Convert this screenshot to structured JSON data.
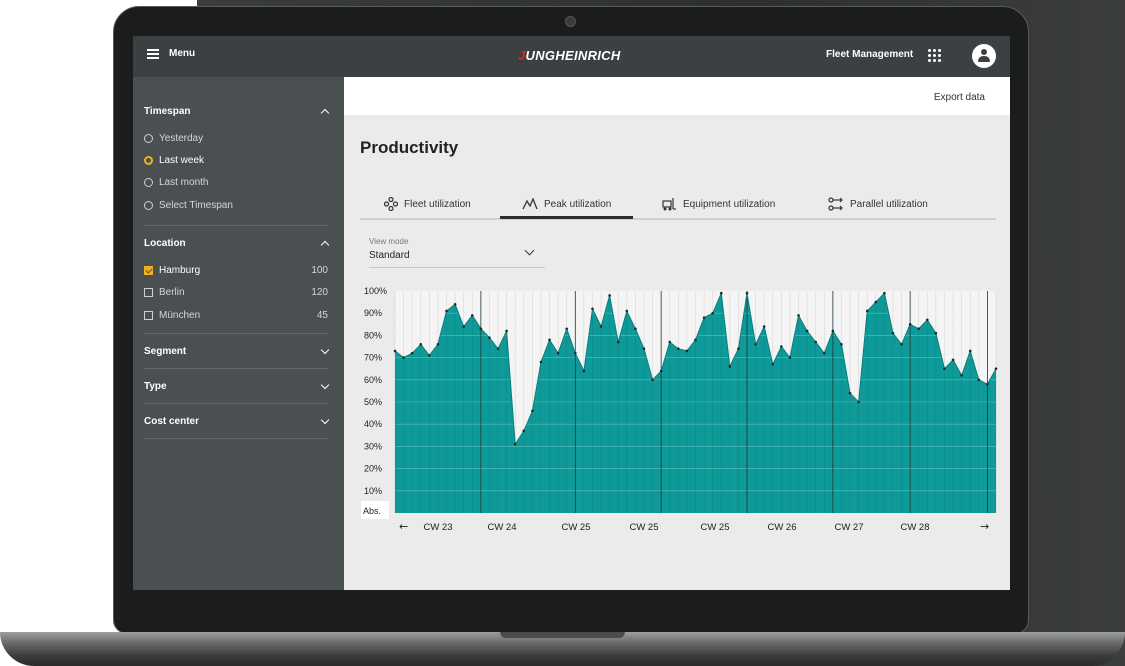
{
  "header": {
    "menu_label": "Menu",
    "logo_text_j": "J",
    "logo_text_rest": "UNGHEINRICH",
    "app_name": "Fleet Management"
  },
  "sidebar": {
    "timespan": {
      "label": "Timespan",
      "options": [
        {
          "label": "Yesterday",
          "selected": false
        },
        {
          "label": "Last week",
          "selected": true
        },
        {
          "label": "Last month",
          "selected": false
        },
        {
          "label": "Select Timespan",
          "selected": false
        }
      ]
    },
    "location": {
      "label": "Location",
      "options": [
        {
          "label": "Hamburg",
          "count": "100",
          "checked": true
        },
        {
          "label": "Berlin",
          "count": "120",
          "checked": false
        },
        {
          "label": "München",
          "count": "45",
          "checked": false
        }
      ]
    },
    "segment_label": "Segment",
    "type_label": "Type",
    "cost_center_label": "Cost center"
  },
  "main": {
    "export_label": "Export data",
    "title": "Productivity",
    "tabs": [
      {
        "label": "Fleet utilization",
        "icon": "fleet-icon",
        "active": false
      },
      {
        "label": "Peak utilization",
        "icon": "peak-icon",
        "active": true
      },
      {
        "label": "Equipment utilization",
        "icon": "forklift-icon",
        "active": false
      },
      {
        "label": "Parallel utilization",
        "icon": "parallel-icon",
        "active": false
      }
    ],
    "view_mode": {
      "label": "View mode",
      "value": "Standard"
    }
  },
  "chart_data": {
    "type": "area",
    "color": "#0f9a9a",
    "y_ticks": [
      "100%",
      "90%",
      "80%",
      "70%",
      "60%",
      "50%",
      "40%",
      "30%",
      "20%",
      "10%"
    ],
    "y_corner_label": "Abs.",
    "ylim": [
      0,
      100
    ],
    "x_labels": [
      "CW 23",
      "CW 24",
      "CW 25",
      "CW 25",
      "CW 25",
      "CW 26",
      "CW 27",
      "CW 28"
    ],
    "prev_arrow": "←",
    "next_arrow": "→",
    "values": [
      73,
      70,
      72,
      76,
      71,
      76,
      91,
      94,
      84,
      89,
      83,
      79,
      74,
      82,
      31,
      37,
      46,
      68,
      78,
      72,
      83,
      72,
      64,
      92,
      84,
      98,
      77,
      91,
      83,
      74,
      60,
      64,
      77,
      74,
      73,
      78,
      88,
      90,
      99,
      66,
      74,
      99,
      76,
      84,
      67,
      75,
      70,
      89,
      82,
      77,
      72,
      82,
      76,
      54,
      50,
      91,
      95,
      99,
      81,
      76,
      85,
      83,
      87,
      81,
      65,
      69,
      62,
      73,
      60,
      58,
      65
    ]
  }
}
